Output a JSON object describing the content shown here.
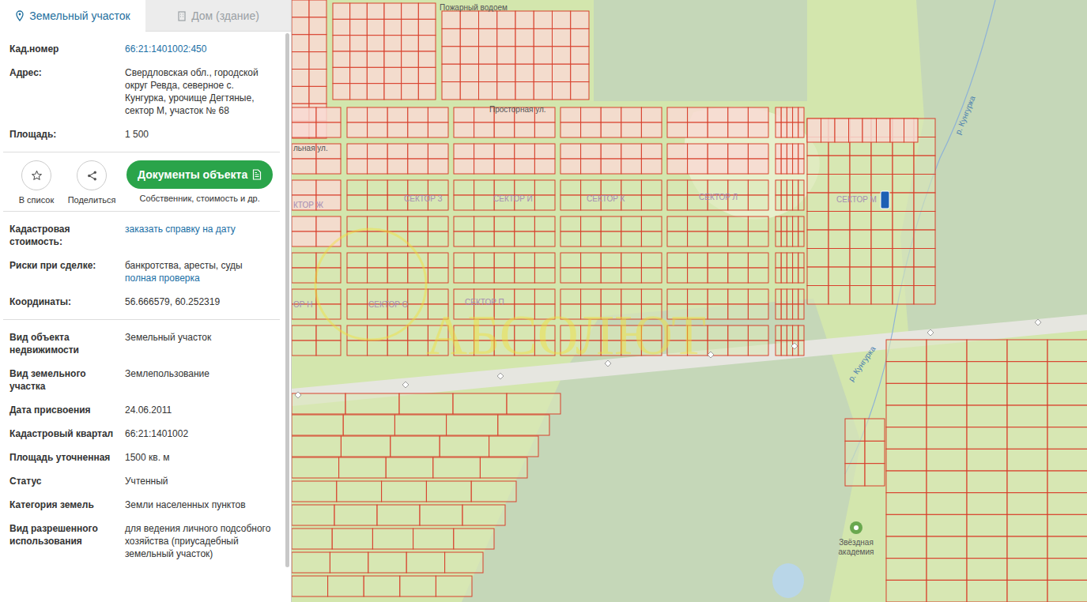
{
  "tabs": [
    {
      "label": "Земельный участок",
      "selected": true,
      "kind": "pin"
    },
    {
      "label": "Дом (здание)",
      "selected": false,
      "kind": "building"
    }
  ],
  "main_fields": [
    {
      "label": "Кад.номер",
      "parts": [
        {
          "text": "66:21:1401002:450",
          "link": true
        }
      ]
    },
    {
      "label": "Адрес:",
      "parts": [
        {
          "text": "Свердловская обл., городской округ Ревда, северное с. Кунгурка, урочище Дегтяные, сектор М, участок № 68",
          "link": false
        }
      ]
    },
    {
      "label": "Площадь:",
      "parts": [
        {
          "text": "1 500",
          "link": false
        }
      ]
    }
  ],
  "actions": [
    {
      "label": "В список",
      "kind": "star"
    },
    {
      "label": "Поделиться",
      "kind": "share"
    }
  ],
  "docs_button": {
    "label": "Документы объекта",
    "caption": "Собственник, стоимость и др."
  },
  "check_fields": [
    {
      "label": "Кадастровая стоимость:",
      "parts": [
        {
          "text": "заказать справку на дату",
          "link": true
        }
      ]
    },
    {
      "label": "Риски при сделке:",
      "parts": [
        {
          "text": "банкротства, аресты, суды",
          "link": false
        },
        {
          "text": "полная проверка",
          "link": true
        }
      ]
    },
    {
      "label": "Координаты:",
      "parts": [
        {
          "text": "56.666579, 60.252319",
          "link": false
        }
      ]
    }
  ],
  "detail_fields": [
    {
      "label": "Вид объекта недвижимости",
      "parts": [
        {
          "text": "Земельный участок",
          "link": false
        }
      ]
    },
    {
      "label": "Вид земельного участка",
      "parts": [
        {
          "text": "Землепользование",
          "link": false
        }
      ]
    },
    {
      "label": "Дата присвоения",
      "parts": [
        {
          "text": "24.06.2011",
          "link": false
        }
      ]
    },
    {
      "label": "Кадастровый квартал",
      "parts": [
        {
          "text": "66:21:1401002",
          "link": false
        }
      ]
    },
    {
      "label": "Площадь уточненная",
      "parts": [
        {
          "text": "1500 кв. м",
          "link": false
        }
      ]
    },
    {
      "label": "Статус",
      "parts": [
        {
          "text": "Учтенный",
          "link": false
        }
      ]
    },
    {
      "label": "Категория земель",
      "parts": [
        {
          "text": "Земли населенных пунктов",
          "link": false
        }
      ]
    },
    {
      "label": "Вид разрешенного использования",
      "parts": [
        {
          "text": "для ведения личного подсобного хозяйства (приусадебный земельный участок)",
          "link": false
        }
      ]
    }
  ],
  "map": {
    "labels": [
      {
        "text": "Пожарный водоем",
        "kind": "street"
      },
      {
        "text": "Просторная ул.",
        "kind": "street"
      },
      {
        "text": "льная ул.",
        "kind": "street"
      },
      {
        "text": "КТОР Ж",
        "kind": "sector"
      },
      {
        "text": "СЕКТОР З",
        "kind": "sector"
      },
      {
        "text": "СЕКТОР И",
        "kind": "sector"
      },
      {
        "text": "СЕКТОР К",
        "kind": "sector"
      },
      {
        "text": "СЕКТОР Л",
        "kind": "sector"
      },
      {
        "text": "СЕКТОР М",
        "kind": "sector"
      },
      {
        "text": "ОР Н",
        "kind": "sector"
      },
      {
        "text": "СЕКТОР О",
        "kind": "sector"
      },
      {
        "text": "СЕКТОР П",
        "kind": "sector"
      },
      {
        "text": "р. Кунгурка",
        "kind": "river"
      },
      {
        "text": "р. Кунгурка",
        "kind": "river"
      }
    ],
    "poi": {
      "lines": [
        "Звёздная",
        "академия"
      ]
    },
    "watermark": "АБСОЛЮТ"
  }
}
